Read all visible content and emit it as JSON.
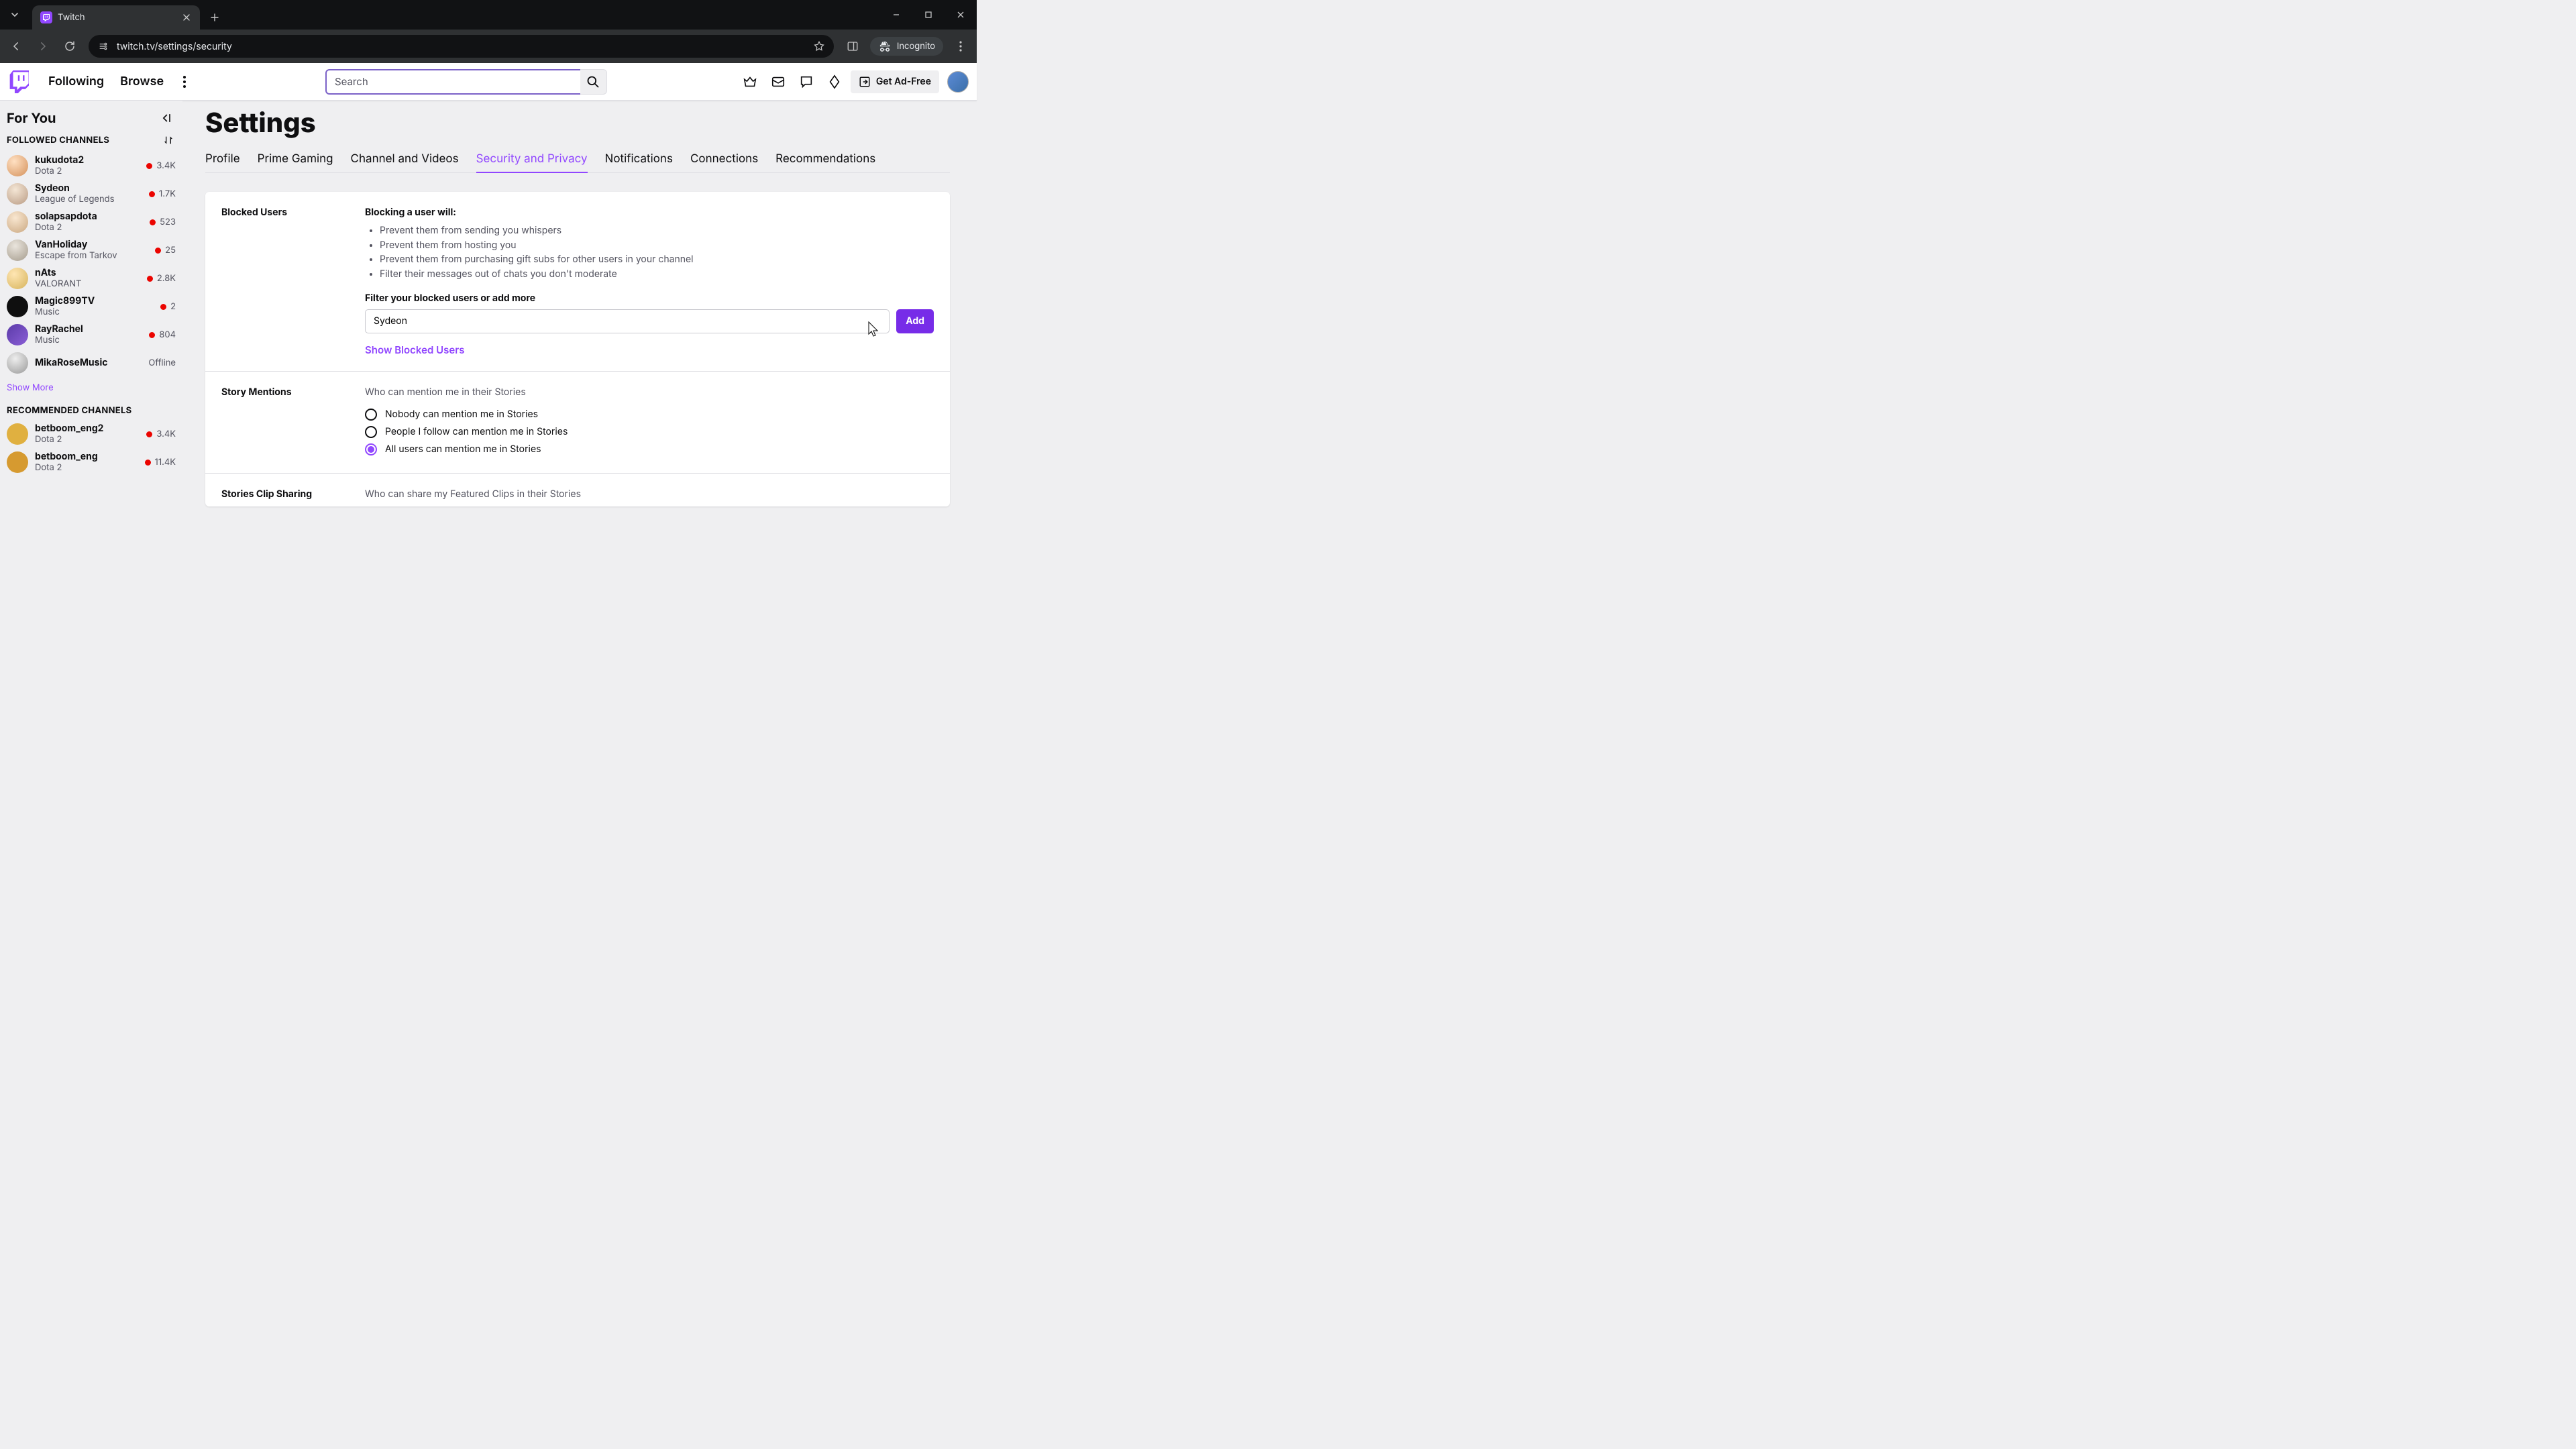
{
  "browser": {
    "tab_title": "Twitch",
    "url": "twitch.tv/settings/security",
    "incognito_label": "Incognito"
  },
  "topnav": {
    "following": "Following",
    "browse": "Browse",
    "search_placeholder": "Search",
    "adfree": "Get Ad-Free"
  },
  "sidebar": {
    "for_you": "For You",
    "followed_heading": "FOLLOWED CHANNELS",
    "recommended_heading": "RECOMMENDED CHANNELS",
    "show_more": "Show More",
    "followed": [
      {
        "name": "kukudota2",
        "game": "Dota 2",
        "viewers": "3.4K",
        "live": true
      },
      {
        "name": "Sydeon",
        "game": "League of Legends",
        "viewers": "1.7K",
        "live": true
      },
      {
        "name": "solapsapdota",
        "game": "Dota 2",
        "viewers": "523",
        "live": true
      },
      {
        "name": "VanHoliday",
        "game": "Escape from Tarkov",
        "viewers": "25",
        "live": true
      },
      {
        "name": "nAts",
        "game": "VALORANT",
        "viewers": "2.8K",
        "live": true
      },
      {
        "name": "Magic899TV",
        "game": "Music",
        "viewers": "2",
        "live": true
      },
      {
        "name": "RayRachel",
        "game": "Music",
        "viewers": "804",
        "live": true
      },
      {
        "name": "MikaRoseMusic",
        "game": "",
        "viewers": "Offline",
        "live": false
      }
    ],
    "recommended": [
      {
        "name": "betboom_eng2",
        "game": "Dota 2",
        "viewers": "3.4K",
        "live": true
      },
      {
        "name": "betboom_eng",
        "game": "Dota 2",
        "viewers": "11.4K",
        "live": true
      }
    ]
  },
  "settings": {
    "title": "Settings",
    "tabs": [
      "Profile",
      "Prime Gaming",
      "Channel and Videos",
      "Security and Privacy",
      "Notifications",
      "Connections",
      "Recommendations"
    ],
    "active_tab_index": 3,
    "blocked": {
      "label": "Blocked Users",
      "lead": "Blocking a user will:",
      "bullets": [
        "Prevent them from sending you whispers",
        "Prevent them from hosting you",
        "Prevent them from purchasing gift subs for other users in your channel",
        "Filter their messages out of chats you don't moderate"
      ],
      "filter_label": "Filter your blocked users or add more",
      "filter_value": "Sydeon",
      "add_label": "Add",
      "show_label": "Show Blocked Users"
    },
    "story_mentions": {
      "label": "Story Mentions",
      "hint": "Who can mention me in their Stories",
      "options": [
        "Nobody can mention me in Stories",
        "People I follow can mention me in Stories",
        "All users can mention me in Stories"
      ],
      "selected_index": 2
    },
    "clip_sharing": {
      "label": "Stories Clip Sharing",
      "hint": "Who can share my Featured Clips in their Stories"
    }
  }
}
